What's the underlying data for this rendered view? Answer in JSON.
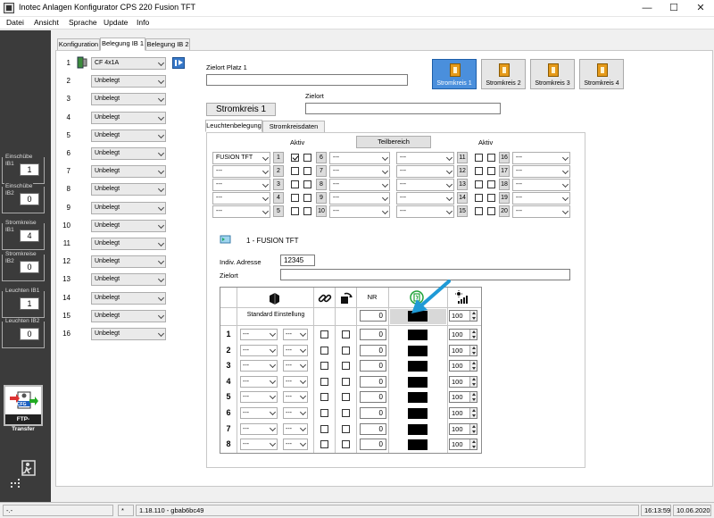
{
  "window": {
    "title": "Inotec Anlagen Konfigurator CPS 220 Fusion TFT",
    "minimize": "—",
    "maximize": "☐",
    "close": "✕"
  },
  "menu": [
    "Datei",
    "Ansicht",
    "Sprache",
    "Update",
    "Info"
  ],
  "sidebar": {
    "groups": [
      {
        "label1": "Einschübe",
        "label2": "IB1",
        "value": "1"
      },
      {
        "label1": "Einschübe",
        "label2": "IB2",
        "value": "0"
      },
      {
        "label1": "Stromkreise",
        "label2": "IB1",
        "value": "4"
      },
      {
        "label1": "Stromkreise",
        "label2": "IB2",
        "value": "0"
      },
      {
        "label1": "Leuchten IB1",
        "label2": "",
        "value": "1"
      },
      {
        "label1": "Leuchten IB2",
        "label2": "",
        "value": "0"
      }
    ],
    "ftp_label": "FTP-Transfer",
    "ftp_cfg": "CFG"
  },
  "tabs": [
    "Konfiguration",
    "Belegung IB 1",
    "Belegung IB 2"
  ],
  "slots": [
    {
      "num": "1",
      "value": "CF 4x1A"
    },
    {
      "num": "2",
      "value": "Unbelegt"
    },
    {
      "num": "3",
      "value": "Unbelegt"
    },
    {
      "num": "4",
      "value": "Unbelegt"
    },
    {
      "num": "5",
      "value": "Unbelegt"
    },
    {
      "num": "6",
      "value": "Unbelegt"
    },
    {
      "num": "7",
      "value": "Unbelegt"
    },
    {
      "num": "8",
      "value": "Unbelegt"
    },
    {
      "num": "9",
      "value": "Unbelegt"
    },
    {
      "num": "10",
      "value": "Unbelegt"
    },
    {
      "num": "11",
      "value": "Unbelegt"
    },
    {
      "num": "12",
      "value": "Unbelegt"
    },
    {
      "num": "13",
      "value": "Unbelegt"
    },
    {
      "num": "14",
      "value": "Unbelegt"
    },
    {
      "num": "15",
      "value": "Unbelegt"
    },
    {
      "num": "16",
      "value": "Unbelegt"
    }
  ],
  "zielort_platz": {
    "label": "Zielort Platz 1",
    "value": ""
  },
  "stromkreis_buttons": [
    "Stromkreis 1",
    "Stromkreis 2",
    "Stromkreis 3",
    "Stromkreis 4"
  ],
  "stromkreis_title": "Stromkreis 1",
  "zielort": {
    "label": "Zielort",
    "value": ""
  },
  "subtabs": [
    "Leuchtenbelegung",
    "Stromkreisdaten"
  ],
  "aktiv_label": "Aktiv",
  "teilbereich_label": "Teilbereich",
  "leuchten": [
    {
      "left": "FUSION TFT",
      "num": "1",
      "checked": true,
      "mid_num": "6",
      "mid": "---",
      "right_sel": "---",
      "r1": "11",
      "r2": "16",
      "far": "---"
    },
    {
      "left": "---",
      "num": "2",
      "checked": false,
      "mid_num": "7",
      "mid": "---",
      "right_sel": "---",
      "r1": "12",
      "r2": "17",
      "far": "---"
    },
    {
      "left": "---",
      "num": "3",
      "checked": false,
      "mid_num": "8",
      "mid": "---",
      "right_sel": "---",
      "r1": "13",
      "r2": "18",
      "far": "---"
    },
    {
      "left": "---",
      "num": "4",
      "checked": false,
      "mid_num": "9",
      "mid": "---",
      "right_sel": "---",
      "r1": "14",
      "r2": "19",
      "far": "---"
    },
    {
      "left": "---",
      "num": "5",
      "checked": false,
      "mid_num": "10",
      "mid": "---",
      "right_sel": "---",
      "r1": "15",
      "r2": "20",
      "far": "---"
    }
  ],
  "device": {
    "title": "1 - FUSION TFT",
    "addr_label": "Indiv. Adresse",
    "addr_value": "12345",
    "zielort_label": "Zielort",
    "zielort_value": ""
  },
  "grid": {
    "nr_header": "NR",
    "standard_label": "Standard Einstellung",
    "standard_nr": "0",
    "standard_pct": "100",
    "rows": [
      {
        "num": "1",
        "a": "---",
        "b": "---",
        "nr": "0",
        "pct": "100"
      },
      {
        "num": "2",
        "a": "---",
        "b": "---",
        "nr": "0",
        "pct": "100"
      },
      {
        "num": "3",
        "a": "---",
        "b": "---",
        "nr": "0",
        "pct": "100"
      },
      {
        "num": "4",
        "a": "---",
        "b": "---",
        "nr": "0",
        "pct": "100"
      },
      {
        "num": "5",
        "a": "---",
        "b": "---",
        "nr": "0",
        "pct": "100"
      },
      {
        "num": "6",
        "a": "---",
        "b": "---",
        "nr": "0",
        "pct": "100"
      },
      {
        "num": "7",
        "a": "---",
        "b": "---",
        "nr": "0",
        "pct": "100"
      },
      {
        "num": "8",
        "a": "---",
        "b": "---",
        "nr": "0",
        "pct": "100"
      }
    ]
  },
  "statusbar": {
    "left": "-.-",
    "star": "*",
    "version": "1.18.110 - gbab6bc49",
    "time": "16:13:59",
    "date": "10.06.2020"
  },
  "colors": {
    "accent": "#4a8fdc",
    "arrow": "#1f9ad6",
    "sidebar": "#3b3b3b"
  }
}
